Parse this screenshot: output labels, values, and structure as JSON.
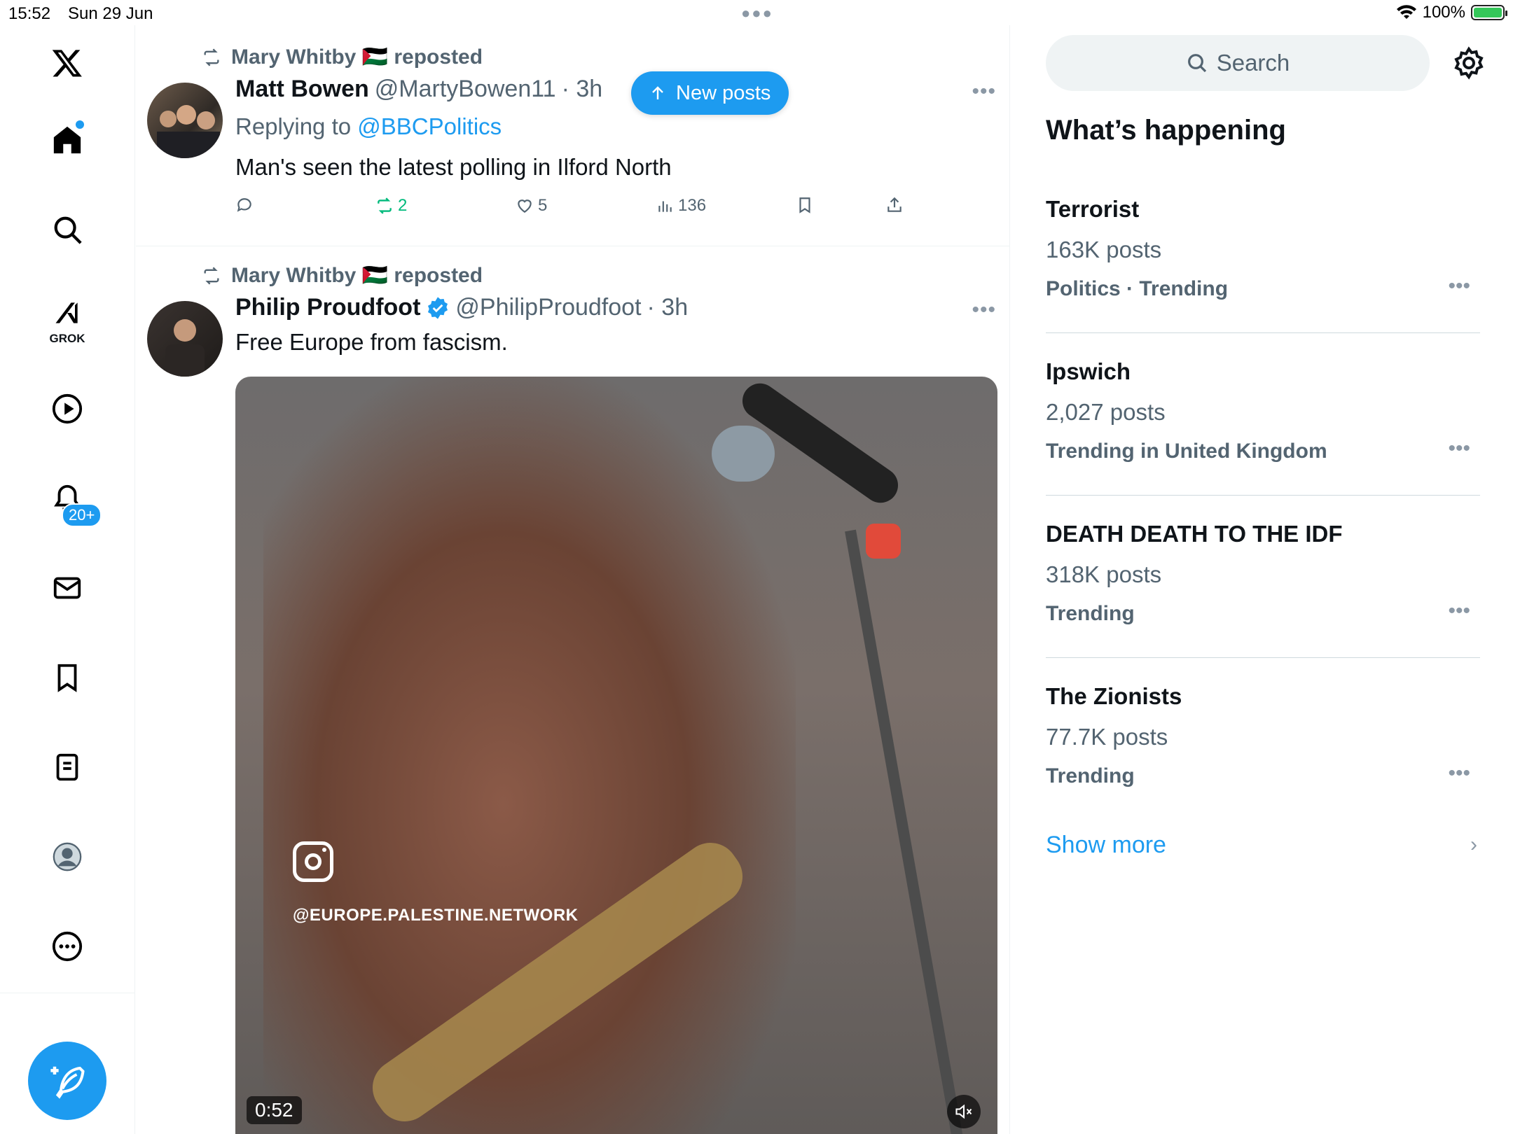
{
  "status_bar": {
    "time": "15:52",
    "date": "Sun 29 Jun",
    "battery": "100%"
  },
  "nav": {
    "grok_label": "GROK",
    "notifications_badge": "20+"
  },
  "new_posts_pill": "New posts",
  "feed": {
    "post1": {
      "reposter": "Mary Whitby 🇵🇸 reposted",
      "name": "Matt Bowen",
      "handle": "@MartyBowen11",
      "time": "· 3h",
      "replying_label": "Replying to",
      "replying_handle": "@BBCPolitics",
      "text": "Man's seen the latest polling in Ilford North",
      "reposts": "2",
      "likes": "5",
      "views": "136"
    },
    "post2": {
      "reposter": "Mary Whitby 🇵🇸 reposted",
      "name": "Philip Proudfoot",
      "handle": "@PhilipProudfoot",
      "time": "· 3h",
      "text": "Free Europe from fascism.",
      "video_watermark": "@EUROPE.PALESTINE.NETWORK",
      "video_duration": "0:52"
    }
  },
  "right": {
    "search_placeholder": "Search",
    "section_title": "What’s happening",
    "trends": [
      {
        "title": "Terrorist",
        "count": "163K posts",
        "category": "Politics · Trending"
      },
      {
        "title": "Ipswich",
        "count": "2,027 posts",
        "category": "Trending in United Kingdom"
      },
      {
        "title": "DEATH DEATH TO THE IDF",
        "count": "318K posts",
        "category": "Trending"
      },
      {
        "title": "The Zionists",
        "count": "77.7K posts",
        "category": "Trending"
      }
    ],
    "show_more": "Show more"
  },
  "colors": {
    "accent": "#1d9bf0",
    "repost_green": "#00ba7c",
    "secondary_text": "#536471"
  }
}
